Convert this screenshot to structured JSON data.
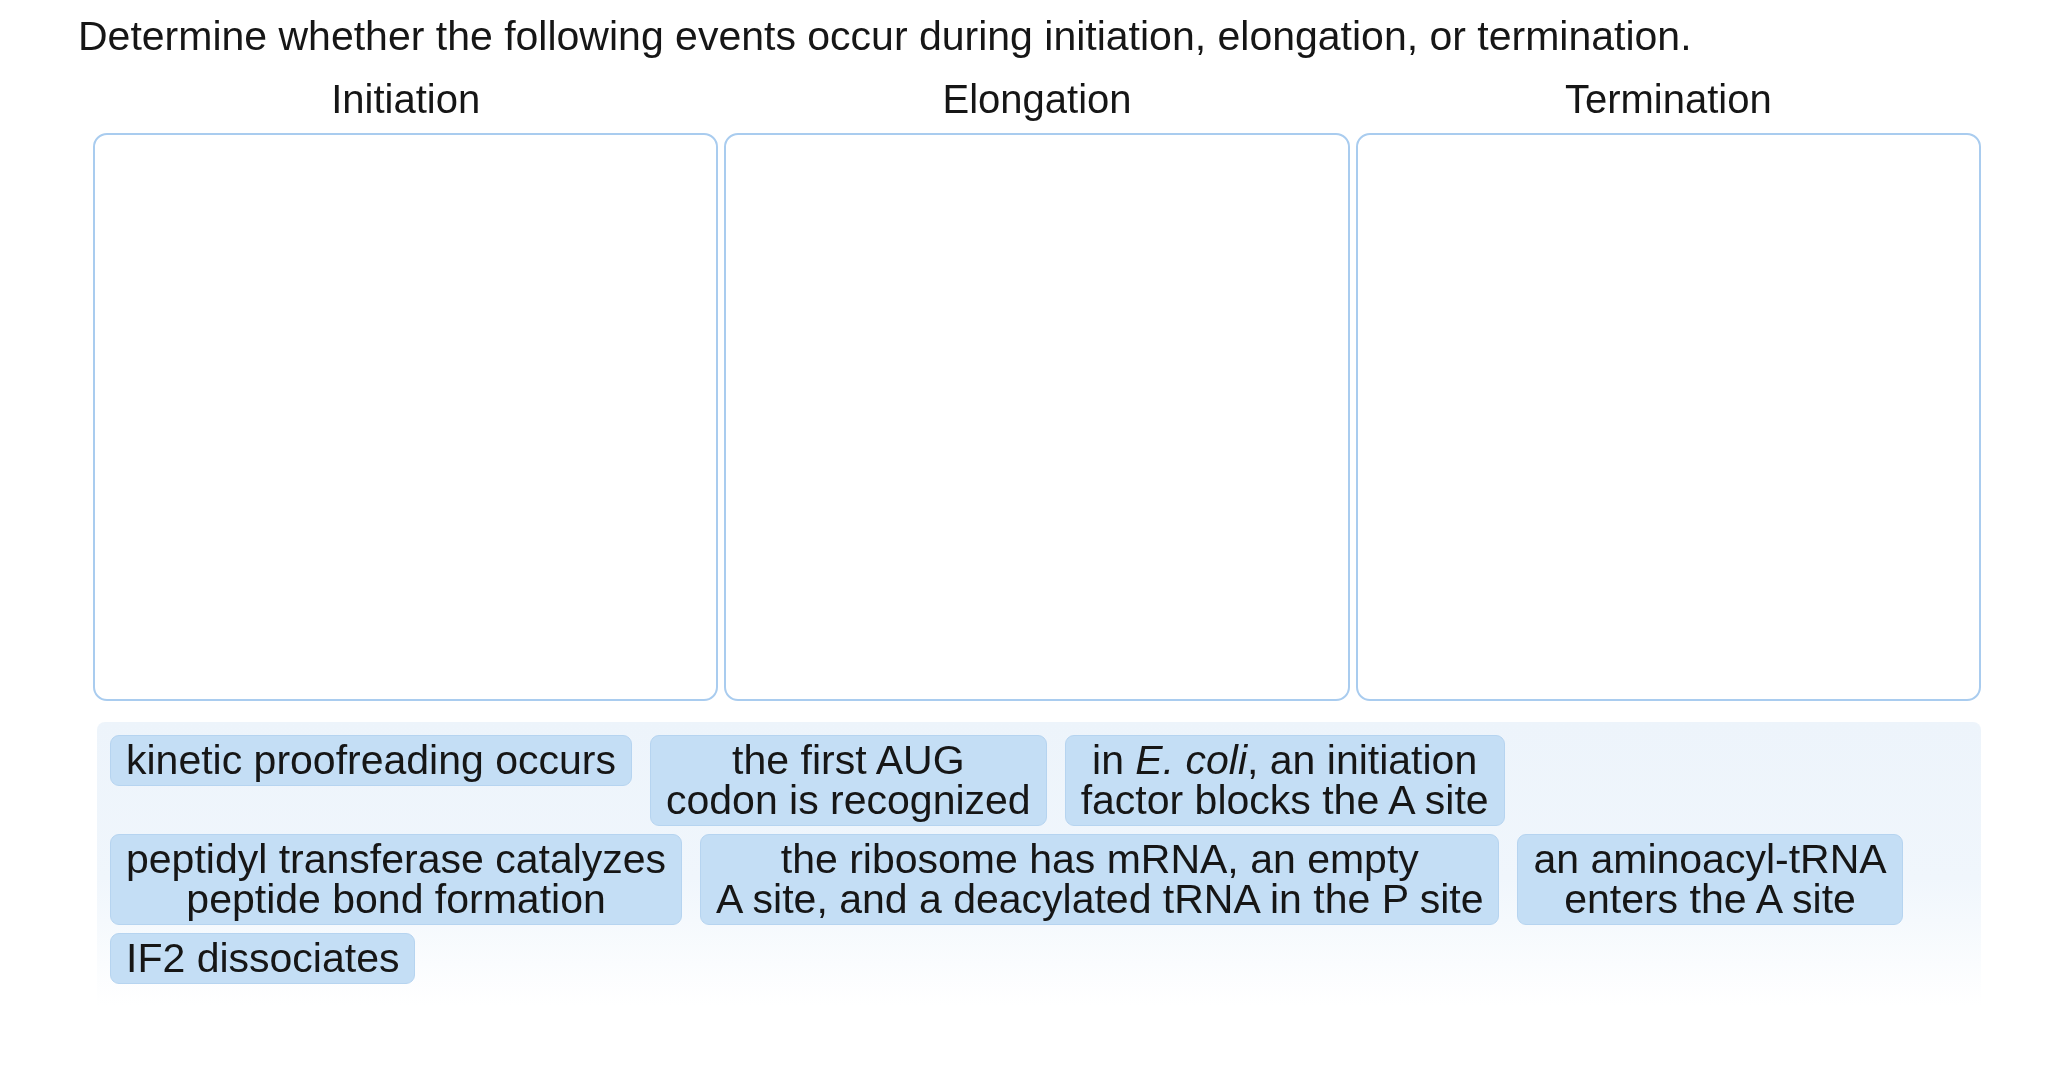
{
  "instruction": "Determine whether the following events occur during initiation, elongation, or termination.",
  "bins": [
    {
      "label": "Initiation"
    },
    {
      "label": "Elongation"
    },
    {
      "label": "Termination"
    }
  ],
  "answer_bank": {
    "items": [
      {
        "lines": [
          "kinetic proofreading occurs"
        ]
      },
      {
        "lines": [
          "the first AUG",
          "codon is recognized"
        ]
      },
      {
        "lines": [
          "in *E. coli*, an initiation",
          "factor blocks the A site"
        ]
      },
      {
        "lines": [
          "peptidyl transferase catalyzes",
          "peptide bond formation"
        ]
      },
      {
        "lines": [
          "the ribosome has mRNA, an empty",
          "A site, and a deacylated tRNA in the P site"
        ]
      },
      {
        "lines": [
          "an aminoacyl-tRNA",
          "enters the A site"
        ]
      },
      {
        "lines": [
          "IF2 dissociates"
        ]
      }
    ]
  }
}
